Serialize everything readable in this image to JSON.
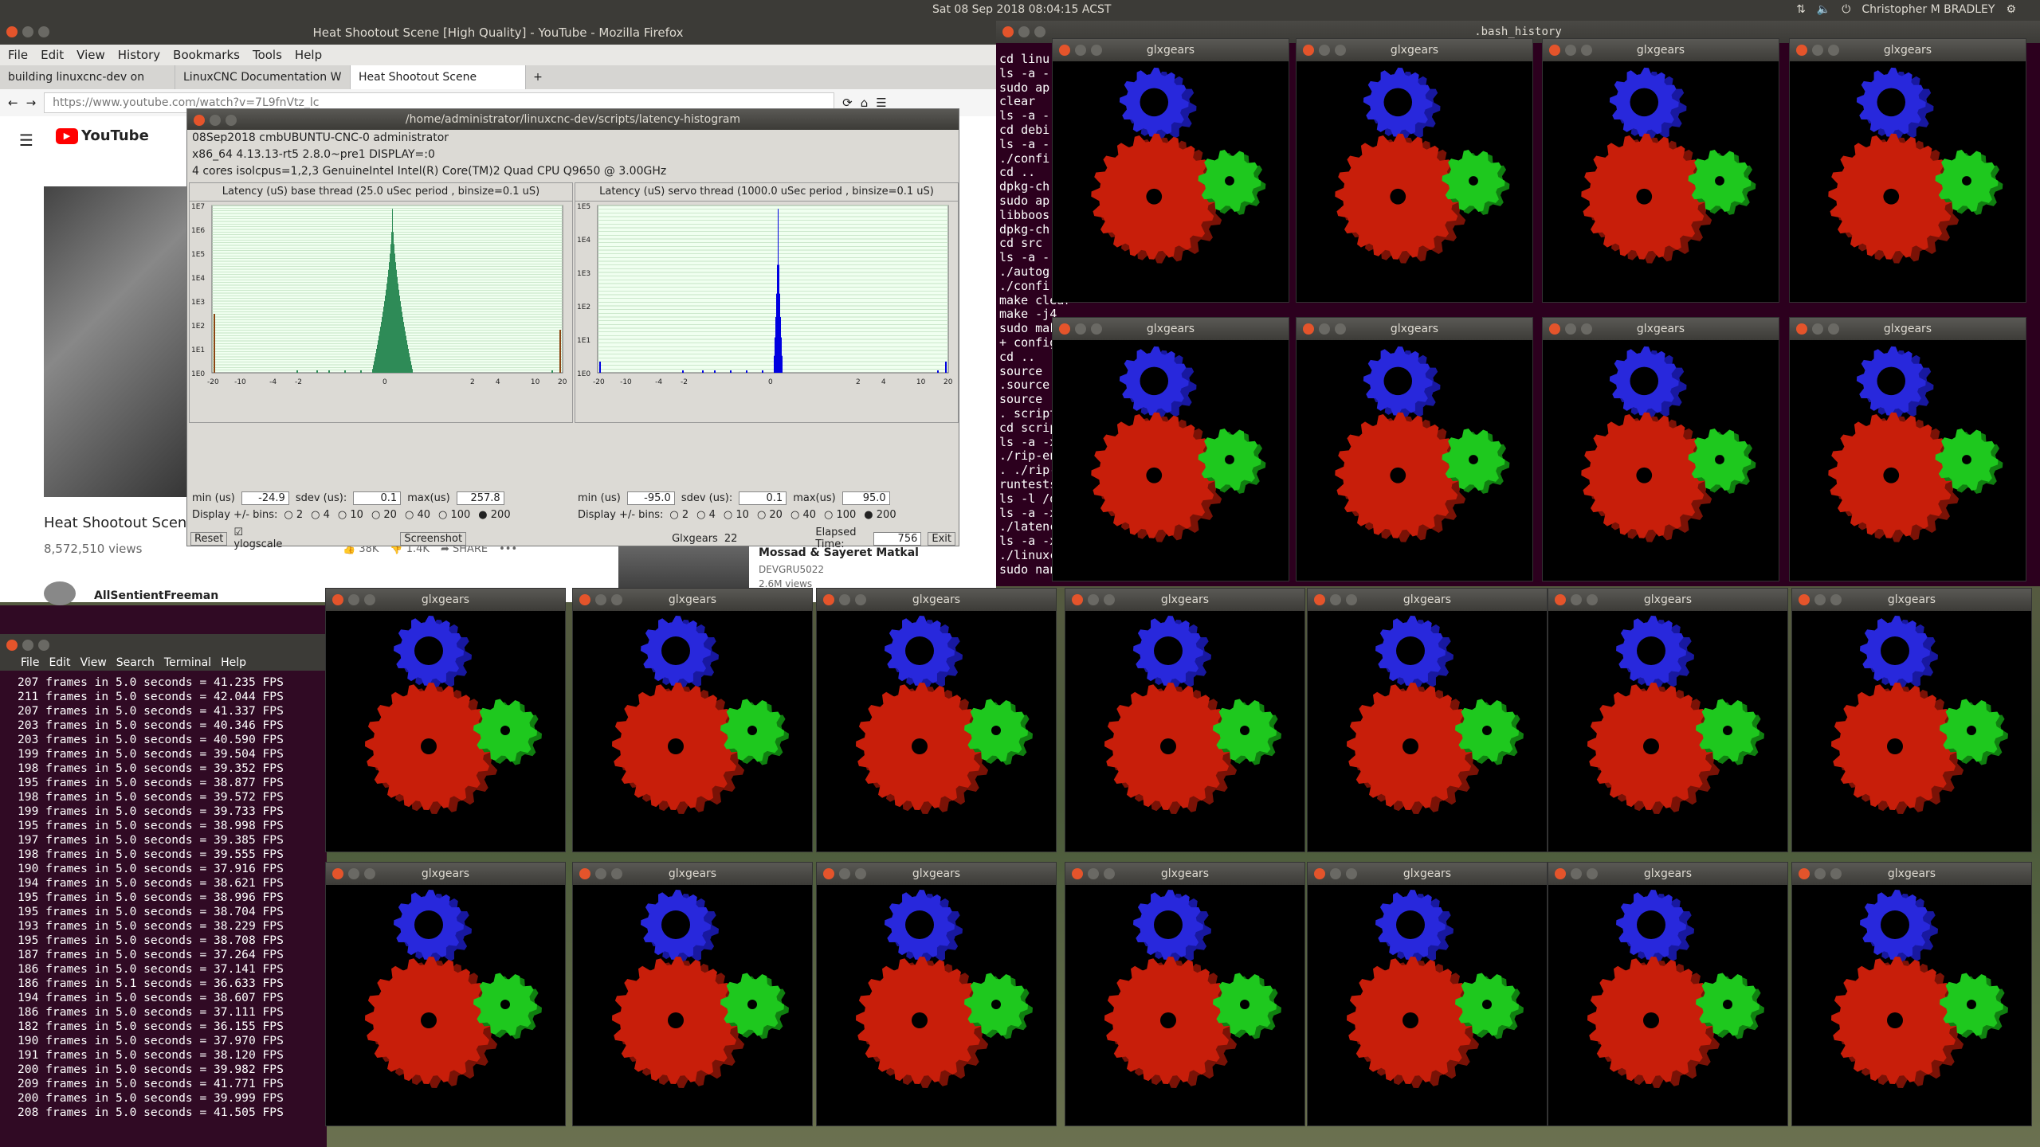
{
  "topbar": {
    "clock": "Sat 08 Sep 2018 08:04:15 ACST",
    "user": "Christopher M BRADLEY"
  },
  "firefox": {
    "title": "Heat Shootout Scene [High Quality] - YouTube - Mozilla Firefox",
    "menu": [
      "File",
      "Edit",
      "View",
      "History",
      "Bookmarks",
      "Tools",
      "Help"
    ],
    "tabs": [
      "building linuxcnc-dev on",
      "LinuxCNC Documentation W",
      "Heat Shootout Scene"
    ],
    "url": "https://www.youtube.com/watch?v=7L9fnVtz_lc",
    "yt": {
      "logo": "YouTube",
      "video_title": "Heat Shootout Scene [",
      "views": "8,572,510 views",
      "likes": "38K",
      "dislikes": "1.4K",
      "share": "SHARE",
      "channel": "AllSentientFreeman",
      "sidebar_title": "Mossad & Sayeret Matkal",
      "sidebar_channel": "DEVGRU5022",
      "sidebar_views": "2.6M views"
    }
  },
  "latency": {
    "path": "/home/administrator/linuxcnc-dev/scripts/latency-histogram",
    "info1": "08Sep2018 cmbUBUNTU-CNC-0 administrator",
    "info2": "x86_64  4.13.13-rt5  2.8.0~pre1  DISPLAY=:0",
    "info3": "4 cores  isolcpus=1,2,3   GenuineIntel  Intel(R) Core(TM)2 Quad CPU Q9650 @ 3.00GHz",
    "base_title": "Latency (uS) base thread (25.0 uSec period , binsize=0.1 uS)",
    "servo_title": "Latency (uS) servo thread (1000.0 uSec period , binsize=0.1 uS)",
    "base_ylabels": [
      "1E7",
      "1E6",
      "1E5",
      "1E4",
      "1E3",
      "1E2",
      "1E1",
      "1E0"
    ],
    "servo_ylabels": [
      "1E5",
      "1E4",
      "1E3",
      "1E2",
      "1E1",
      "1E0"
    ],
    "x_labels": [
      "-20",
      "-10",
      "-4",
      "-2",
      "0",
      "2",
      "4",
      "10",
      "20"
    ],
    "base_stats": {
      "min_label": "min (us)",
      "min": "-24.9",
      "sdev_label": "sdev (us):",
      "sdev": "0.1",
      "max_label": "max(us)",
      "max": "257.8"
    },
    "servo_stats": {
      "min_label": "min (us)",
      "min": "-95.0",
      "sdev_label": "sdev (us):",
      "sdev": "0.1",
      "max_label": "max(us)",
      "max": "95.0"
    },
    "bins_label": "Display +/- bins:",
    "bins": [
      "2",
      "4",
      "10",
      "20",
      "40",
      "100",
      "200"
    ],
    "reset": "Reset",
    "ylogscale": "ylogscale",
    "screenshot": "Screenshot",
    "glxgears_label": "Glxgears",
    "glxgears_count": "22",
    "elapsed_label": "Elapsed Time:",
    "elapsed": "756",
    "exit": "Exit"
  },
  "bash": {
    "title": ".bash_history",
    "lines": [
      "cd linu",
      "ls -a -",
      "sudo ap",
      "clear",
      "ls -a -",
      "cd debi",
      "ls -a -",
      "./confi",
      "cd ..",
      "dpkg-ch",
      "sudo ap",
      "libboos",
      "dpkg-ch",
      "cd src",
      "ls -a -",
      "./autog",
      "./confi",
      "make clear",
      "make -j4",
      "sudo mak",
      "+ config",
      "cd ..",
      "source .",
      ".source",
      "source .",
      ". script",
      "cd scrip",
      "ls -a -x",
      "./rip-en",
      ". ./rip-",
      "runtests",
      "ls -l /d",
      "ls -a -x",
      "./latenc",
      "ls -a -x",
      "./linuxc",
      "sudo nano /etc/default/grub"
    ]
  },
  "fps": {
    "menu": [
      "File",
      "Edit",
      "View",
      "Search",
      "Terminal",
      "Help"
    ],
    "lines": [
      "207 frames in 5.0 seconds = 41.235 FPS",
      "211 frames in 5.0 seconds = 42.044 FPS",
      "207 frames in 5.0 seconds = 41.337 FPS",
      "203 frames in 5.0 seconds = 40.346 FPS",
      "203 frames in 5.0 seconds = 40.590 FPS",
      "199 frames in 5.0 seconds = 39.504 FPS",
      "198 frames in 5.0 seconds = 39.352 FPS",
      "195 frames in 5.0 seconds = 38.877 FPS",
      "198 frames in 5.0 seconds = 39.572 FPS",
      "199 frames in 5.0 seconds = 39.733 FPS",
      "195 frames in 5.0 seconds = 38.998 FPS",
      "197 frames in 5.0 seconds = 39.385 FPS",
      "198 frames in 5.0 seconds = 39.555 FPS",
      "190 frames in 5.0 seconds = 37.916 FPS",
      "194 frames in 5.0 seconds = 38.621 FPS",
      "195 frames in 5.0 seconds = 38.996 FPS",
      "195 frames in 5.0 seconds = 38.704 FPS",
      "193 frames in 5.0 seconds = 38.229 FPS",
      "195 frames in 5.0 seconds = 38.708 FPS",
      "187 frames in 5.0 seconds = 37.264 FPS",
      "186 frames in 5.0 seconds = 37.141 FPS",
      "186 frames in 5.1 seconds = 36.633 FPS",
      "194 frames in 5.0 seconds = 38.607 FPS",
      "186 frames in 5.0 seconds = 37.111 FPS",
      "182 frames in 5.0 seconds = 36.155 FPS",
      "190 frames in 5.0 seconds = 37.970 FPS",
      "191 frames in 5.0 seconds = 38.120 FPS",
      "200 frames in 5.0 seconds = 39.982 FPS",
      "209 frames in 5.0 seconds = 41.771 FPS",
      "200 frames in 5.0 seconds = 39.999 FPS",
      "208 frames in 5.0 seconds = 41.505 FPS"
    ]
  },
  "glxgears": {
    "title": "glxgears",
    "count": 22
  },
  "colors": {
    "red_gear": "#c81e0a",
    "green_gear": "#1ec81e",
    "blue_gear": "#2828dc",
    "base_hist": "#2e8b57",
    "servo_hist": "#0000e0"
  }
}
